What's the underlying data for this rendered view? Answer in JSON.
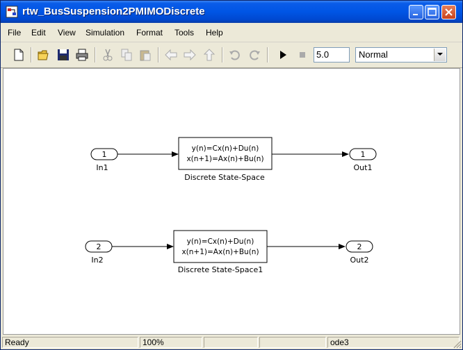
{
  "window": {
    "title": "rtw_BusSuspension2PMIMODiscrete"
  },
  "menu": [
    "File",
    "Edit",
    "View",
    "Simulation",
    "Format",
    "Tools",
    "Help"
  ],
  "toolbar": {
    "icons": [
      "new-icon",
      "open-icon",
      "save-icon",
      "print-icon",
      "cut-icon",
      "copy-icon",
      "paste-icon",
      "back-icon",
      "forward-icon",
      "up-icon",
      "undo-icon",
      "redo-icon",
      "start-simulation-icon",
      "stop-simulation-icon"
    ],
    "stop_time": "5.0",
    "sim_mode": "Normal"
  },
  "diagram": {
    "row1": {
      "inport": {
        "number": "1",
        "label": "In1"
      },
      "block": {
        "line1": "y(n)=Cx(n)+Du(n)",
        "line2": "x(n+1)=Ax(n)+Bu(n)",
        "label": "Discrete State-Space"
      },
      "outport": {
        "number": "1",
        "label": "Out1"
      }
    },
    "row2": {
      "inport": {
        "number": "2",
        "label": "In2"
      },
      "block": {
        "line1": "y(n)=Cx(n)+Du(n)",
        "line2": "x(n+1)=Ax(n)+Bu(n)",
        "label": "Discrete State-Space1"
      },
      "outport": {
        "number": "2",
        "label": "Out2"
      }
    }
  },
  "status": {
    "state": "Ready",
    "zoom": "100%",
    "solver": "ode3"
  }
}
